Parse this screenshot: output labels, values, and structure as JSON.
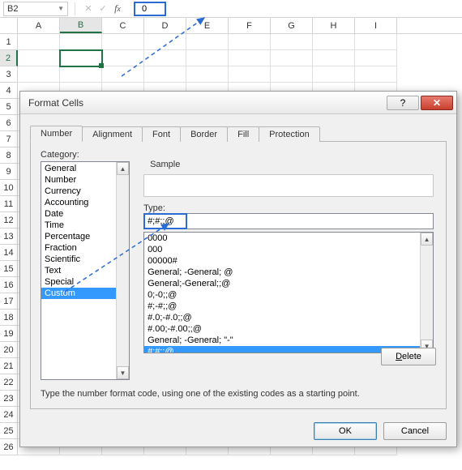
{
  "formula_bar": {
    "name_box": "B2",
    "value": "0"
  },
  "grid": {
    "columns": [
      "A",
      "B",
      "C",
      "D",
      "E",
      "F",
      "G",
      "H",
      "I"
    ],
    "visible_rows": 26,
    "active_col": "B",
    "active_row": 2
  },
  "dialog": {
    "title": "Format Cells",
    "tabs": [
      "Number",
      "Alignment",
      "Font",
      "Border",
      "Fill",
      "Protection"
    ],
    "active_tab": 0,
    "category_label": "Category:",
    "categories": [
      "General",
      "Number",
      "Currency",
      "Accounting",
      "Date",
      "Time",
      "Percentage",
      "Fraction",
      "Scientific",
      "Text",
      "Special",
      "Custom"
    ],
    "selected_category": 11,
    "sample_label": "Sample",
    "type_label": "Type:",
    "type_value": "#;#;;@",
    "format_list": [
      "0000",
      "000",
      "00000#",
      "General; -General; @",
      "General;-General;;@",
      "0;-0;;@",
      "#;-#;;@",
      "#.0;-#.0;;@",
      "#.00;-#.00;;@",
      "General; -General; \"-\"",
      "#;#;;@"
    ],
    "selected_format": 10,
    "delete_label": "Delete",
    "hint": "Type the number format code, using one of the existing codes as a starting point.",
    "ok_label": "OK",
    "cancel_label": "Cancel"
  }
}
